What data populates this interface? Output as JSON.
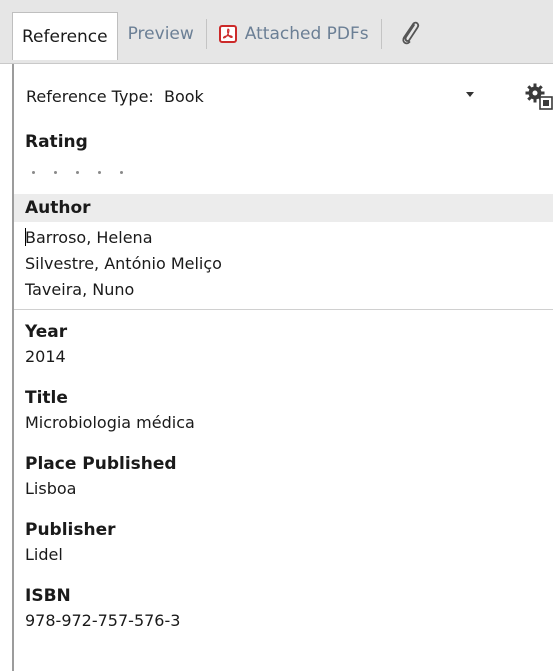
{
  "tabs": [
    {
      "label": "Reference",
      "active": true
    },
    {
      "label": "Preview",
      "active": false
    },
    {
      "label": "Attached PDFs",
      "active": false,
      "icon": "pdf-icon"
    },
    {
      "label": "",
      "icon": "paperclip-icon"
    }
  ],
  "reference_type": {
    "label": "Reference Type:",
    "value": "Book",
    "display": "Reference Type:  Book"
  },
  "rating": {
    "label": "Rating",
    "value": 0,
    "max": 5
  },
  "author": {
    "label": "Author",
    "lines": [
      "Barroso, Helena",
      "Silvestre, António Meliço",
      "Taveira, Nuno"
    ]
  },
  "fields": {
    "year": {
      "label": "Year",
      "value": "2014"
    },
    "title": {
      "label": "Title",
      "value": "Microbiologia médica"
    },
    "place_published": {
      "label": "Place Published",
      "value": "Lisboa"
    },
    "publisher": {
      "label": "Publisher",
      "value": "Lidel"
    },
    "isbn": {
      "label": "ISBN",
      "value": "978-972-757-576-3"
    }
  },
  "colors": {
    "pdf_red": "#cc2a2a",
    "tab_inactive_text": "#6b7f95",
    "tab_bg": "#e6e6e6"
  }
}
